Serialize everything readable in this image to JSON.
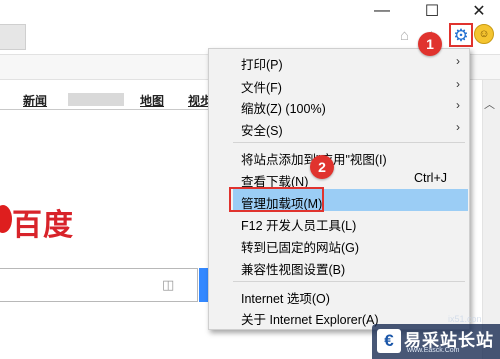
{
  "window": {
    "minimize_glyph": "—",
    "maximize_glyph": "☐",
    "close_glyph": "✕"
  },
  "toolbar": {
    "icons": [
      "home-icon",
      "favorites-star-icon",
      "gear-icon",
      "smiley-feedback-icon"
    ]
  },
  "page": {
    "nav_links": [
      "新闻",
      "地图",
      "视步"
    ],
    "logo_text": "百度"
  },
  "menu": {
    "items": [
      {
        "label": "打印(P)",
        "submenu": true
      },
      {
        "label": "文件(F)",
        "submenu": true
      },
      {
        "label": "缩放(Z) (100%)",
        "submenu": true
      },
      {
        "label": "安全(S)",
        "submenu": true
      },
      {
        "label": "将站点添加到\"应用\"视图(I)",
        "submenu": false
      },
      {
        "label": "查看下载(N)",
        "submenu": false,
        "shortcut": "Ctrl+J"
      },
      {
        "label": "管理加载项(M)",
        "submenu": false,
        "highlighted": true
      },
      {
        "label": "F12 开发人员工具(L)",
        "submenu": false
      },
      {
        "label": "转到已固定的网站(G)",
        "submenu": false
      },
      {
        "label": "兼容性视图设置(B)",
        "submenu": false
      },
      {
        "label": "Internet 选项(O)",
        "submenu": false
      },
      {
        "label": "关于 Internet Explorer(A)",
        "submenu": false
      }
    ],
    "highlight_color": "#9bcdf5"
  },
  "annotations": {
    "badge1": "1",
    "badge2": "2",
    "badge_color": "#e0332e"
  },
  "watermark": {
    "brand": "易采站长站",
    "url": "www.Easck.Com",
    "faint": "ix51.con"
  }
}
